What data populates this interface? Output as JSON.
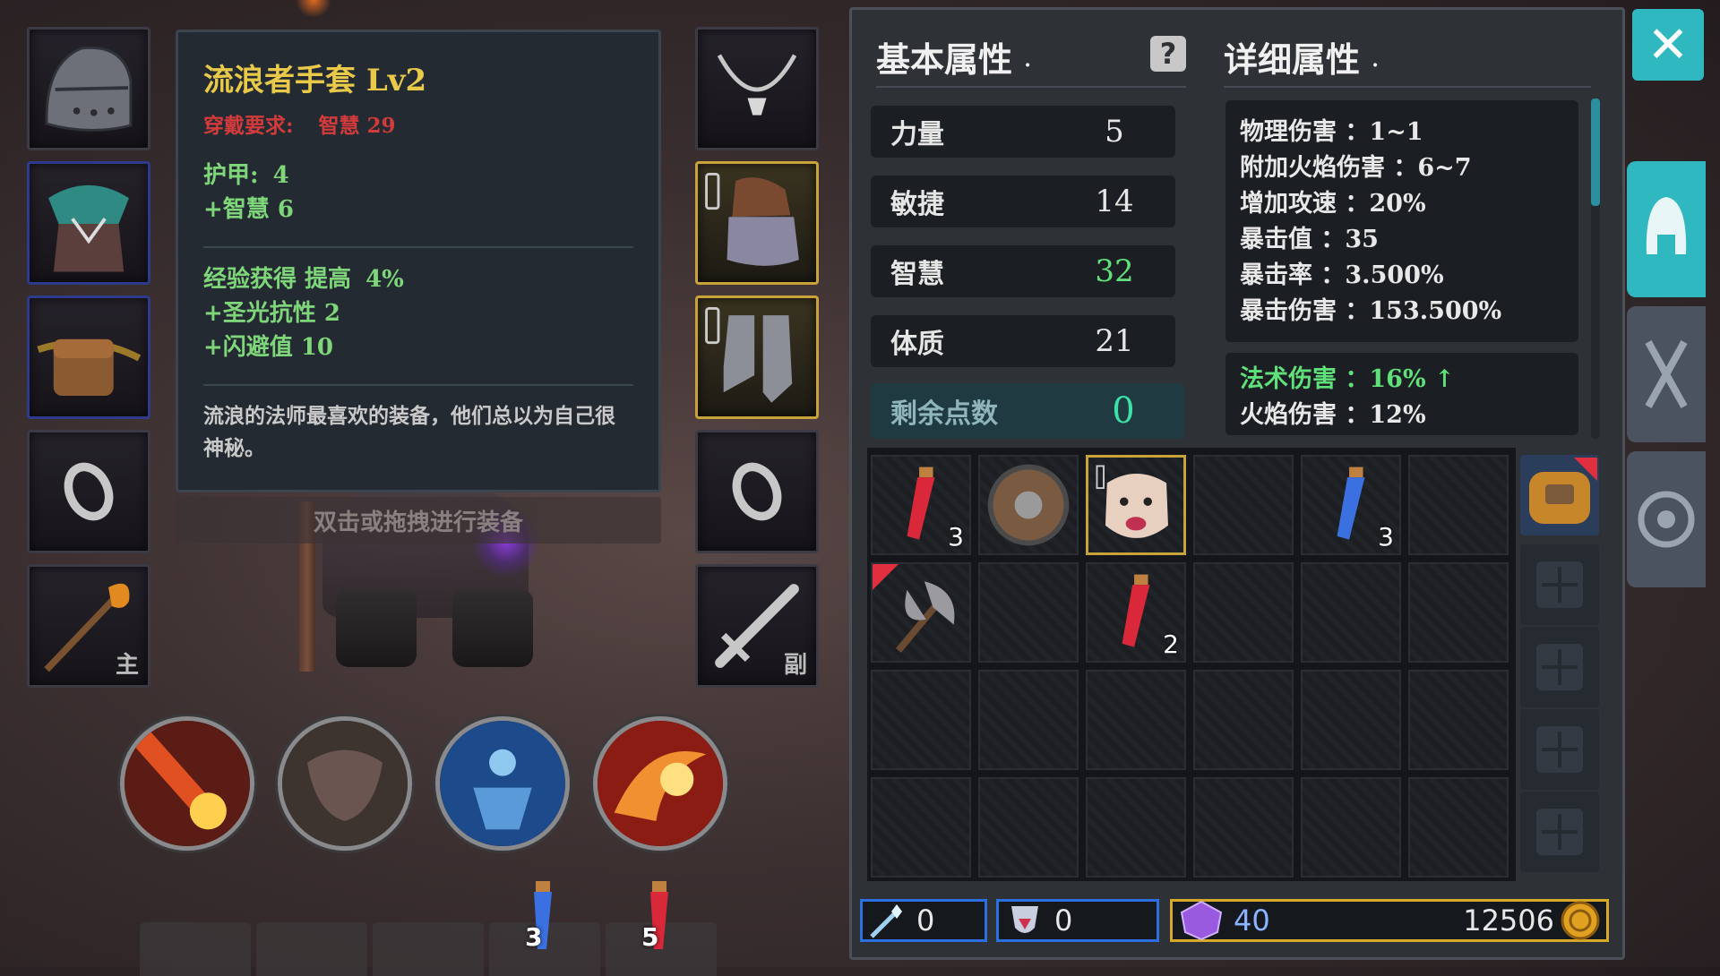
{
  "tooltip": {
    "title": "流浪者手套 Lv2",
    "req_label": "穿戴要求:",
    "req_value": "智慧 29",
    "armor_label": "护甲:",
    "armor_value": "4",
    "stat1": "+智慧 6",
    "bonus1_label": "经验获得 提高",
    "bonus1_value": "4%",
    "bonus2": "+圣光抗性 2",
    "bonus3": "+闪避值 10",
    "desc": "流浪的法师最喜欢的装备，他们总以为自己很神秘。",
    "hint": "双击或拖拽进行装备"
  },
  "equip": {
    "weapon_main_tag": "主",
    "weapon_off_tag": "副"
  },
  "hotbar": {
    "potion_blue": "3",
    "potion_red": "5"
  },
  "basic": {
    "header": "基本属性",
    "header_dot": "·",
    "help": "?",
    "stats": [
      {
        "label": "力量",
        "value": "5"
      },
      {
        "label": "敏捷",
        "value": "14"
      },
      {
        "label": "智慧",
        "value": "32"
      },
      {
        "label": "体质",
        "value": "21"
      }
    ],
    "remain_label": "剩余点数",
    "remain_value": "0"
  },
  "detail": {
    "header": "详细属性",
    "header_dot": "·",
    "lines": [
      "物理伤害 ：1~1",
      "附加火焰伤害 ：6~7",
      "增加攻速 ：20%",
      "暴击值 ：35",
      "暴击率 ：3.500%",
      "暴击伤害 ：153.500%"
    ],
    "spell_line": "法术伤害 ：16% ↑",
    "fire_line": "火焰伤害 ：12%"
  },
  "inventory": {
    "counts": {
      "red_potion_a": "3",
      "blue_potion": "3",
      "red_potion_b": "2"
    }
  },
  "currency": {
    "crystal": "0",
    "shard": "0",
    "gem": "40",
    "gold": "12506"
  },
  "close": "✕",
  "colors": {
    "accent": "#2fb8c0",
    "gold_border": "#c7a33a",
    "green": "#5fe07a",
    "req_red": "#d13b3b"
  }
}
